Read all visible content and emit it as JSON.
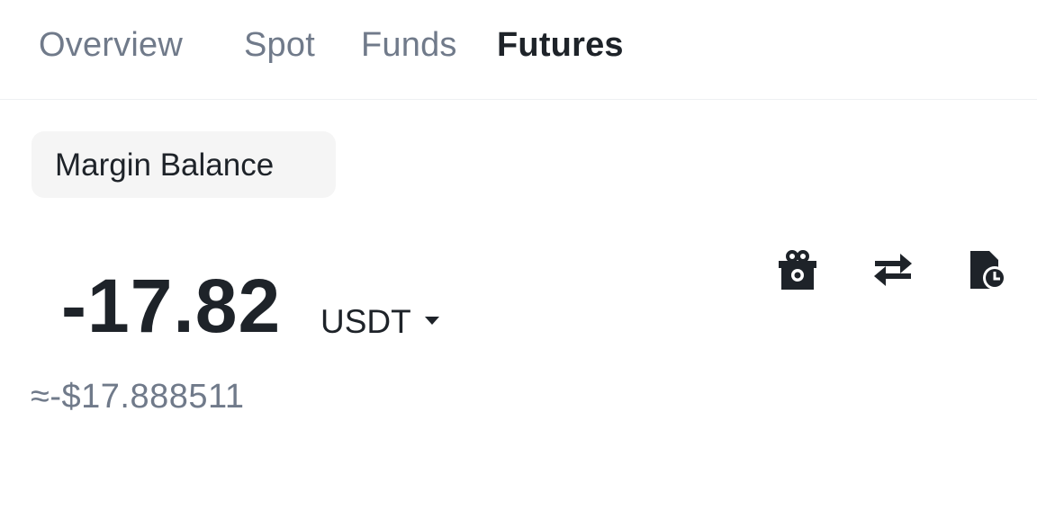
{
  "tabs": [
    {
      "label": "Overview",
      "active": false
    },
    {
      "label": "Spot",
      "active": false
    },
    {
      "label": "Funds",
      "active": false
    },
    {
      "label": "Futures",
      "active": true
    }
  ],
  "balance": {
    "chip_label": "Margin Balance",
    "amount": "-17.82",
    "currency": "USDT",
    "fiat_value": "≈-$17.888511"
  },
  "actions": [
    {
      "icon": "gift-icon"
    },
    {
      "icon": "transfer-icon"
    },
    {
      "icon": "history-icon"
    }
  ],
  "colors": {
    "text_primary": "#1e2329",
    "text_secondary": "#707a8a",
    "chip_bg": "#f5f5f5"
  }
}
